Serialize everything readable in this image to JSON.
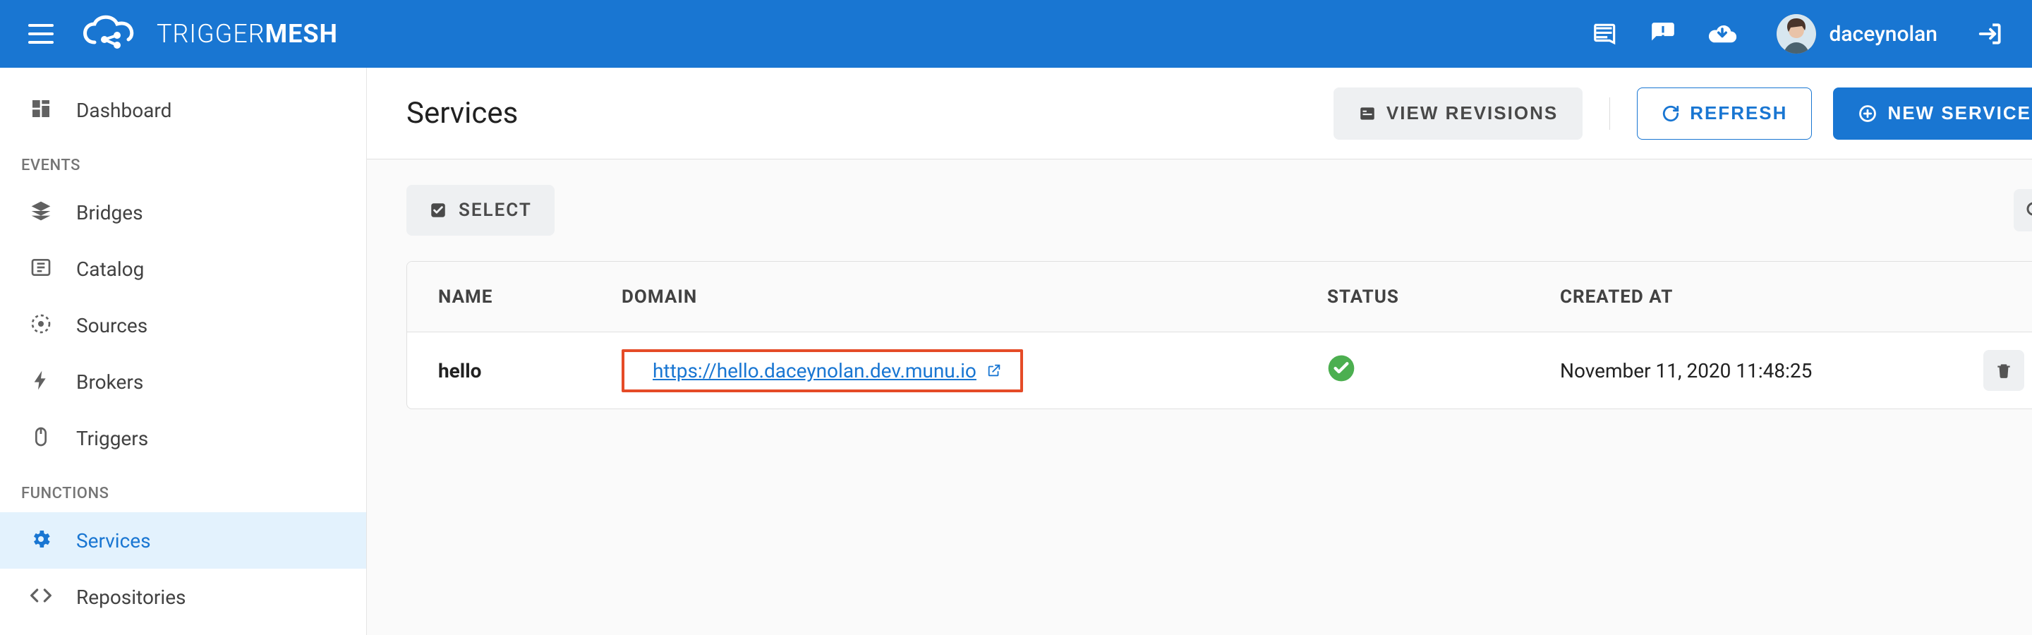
{
  "brand": {
    "name_light": "TRIGGER",
    "name_bold": "MESH"
  },
  "user": {
    "name": "daceynolan"
  },
  "sidebar": {
    "section_events": "EVENTS",
    "section_functions": "FUNCTIONS",
    "items": {
      "dashboard": "Dashboard",
      "bridges": "Bridges",
      "catalog": "Catalog",
      "sources": "Sources",
      "brokers": "Brokers",
      "triggers": "Triggers",
      "services": "Services",
      "repositories": "Repositories"
    }
  },
  "page": {
    "title": "Services",
    "actions": {
      "view_revisions": "VIEW REVISIONS",
      "refresh": "REFRESH",
      "new_service": "NEW SERVICE",
      "select": "SELECT"
    }
  },
  "table": {
    "headers": {
      "name": "NAME",
      "domain": "DOMAIN",
      "status": "STATUS",
      "created_at": "CREATED AT"
    },
    "rows": [
      {
        "name": "hello",
        "domain": "https://hello.daceynolan.dev.munu.io",
        "status": "ok",
        "created_at": "November 11, 2020 11:48:25"
      }
    ]
  }
}
